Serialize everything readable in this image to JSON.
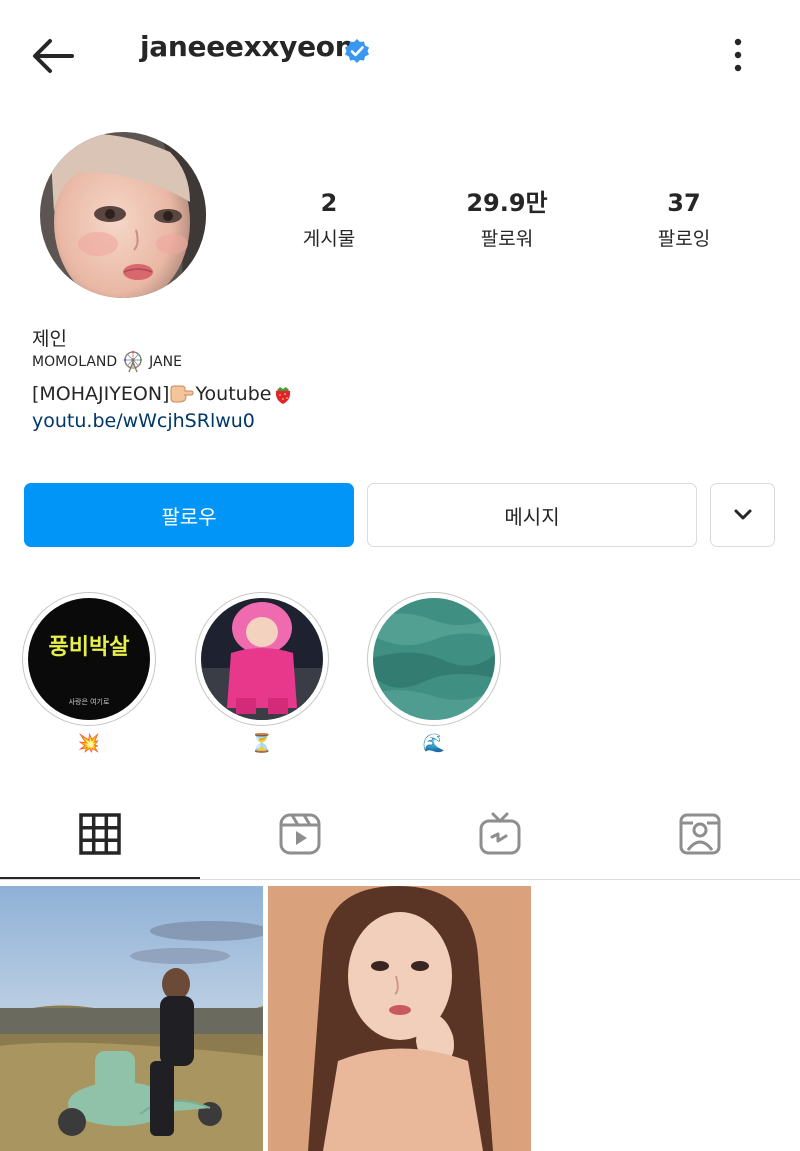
{
  "header": {
    "username": "janeeexxyeon",
    "verified": true
  },
  "stats": [
    {
      "value": "2",
      "label": "게시물"
    },
    {
      "value": "29.9만",
      "label": "팔로워"
    },
    {
      "value": "37",
      "label": "팔로잉"
    }
  ],
  "bio": {
    "name": "제인",
    "category_left": "MOMOLAND",
    "category_emoji": "ferris-wheel",
    "category_right": "JANE",
    "line_text_1": "[MOHAJIYEON]",
    "line_text_2": "Youtube",
    "line_emojis": [
      "pointing-hand",
      "strawberry"
    ],
    "link": "youtu.be/wWcjhSRlwu0"
  },
  "actions": {
    "follow": "팔로우",
    "message": "메시지"
  },
  "highlights": [
    {
      "emoji": "💥",
      "cover_text": "풍비박살",
      "cover_subtext": "사랑은 여기로"
    },
    {
      "emoji": "⏳"
    },
    {
      "emoji": "🌊"
    }
  ],
  "tabs": [
    "posts-grid",
    "reels",
    "igtv",
    "tagged"
  ],
  "colors": {
    "primary_button": "#0095f6",
    "verified_badge": "#3897f0",
    "link": "#00376b",
    "border": "#dbdbdb"
  }
}
